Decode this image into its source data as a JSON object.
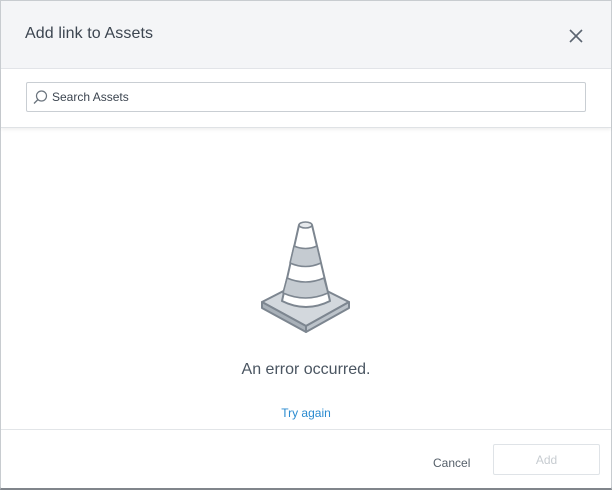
{
  "dialog": {
    "title": "Add link to Assets",
    "close_icon": "close-icon"
  },
  "search": {
    "placeholder": "Search Assets",
    "value": "",
    "icon": "search-icon"
  },
  "empty_state": {
    "icon": "traffic-cone-icon",
    "message": "An error occurred.",
    "retry_label": "Try again"
  },
  "footer": {
    "cancel_label": "Cancel",
    "add_label": "Add",
    "add_enabled": false
  },
  "colors": {
    "header_bg": "#f4f5f7",
    "link": "#2b8bd0",
    "disabled_text": "#c7ccd1",
    "cone_stroke": "#7d8690",
    "cone_fill": "#c5cbd1"
  }
}
